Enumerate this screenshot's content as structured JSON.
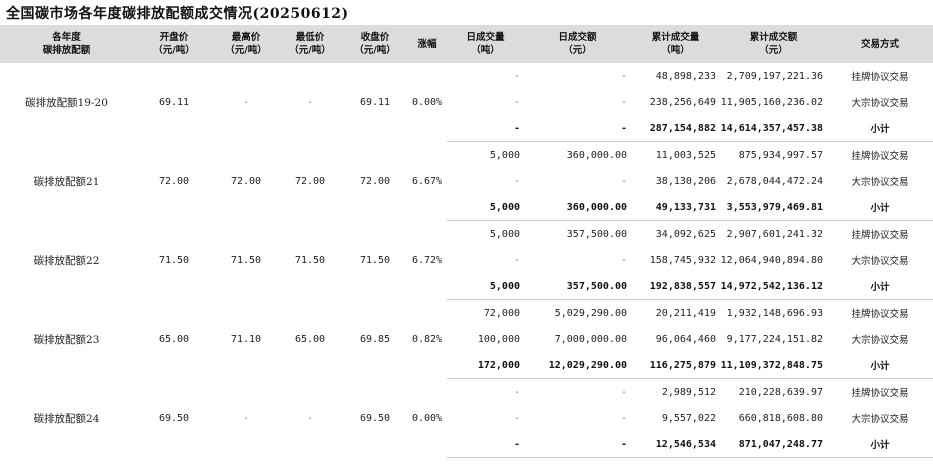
{
  "title": "全国碳市场各年度碳排放配额成交情况(20250612)",
  "headers": [
    [
      "各年度",
      "碳排放配额"
    ],
    [
      "开盘价",
      "（元/吨）"
    ],
    [
      "最高价",
      "（元/吨）"
    ],
    [
      "最低价",
      "（元/吨）"
    ],
    [
      "收盘价",
      "（元/吨）"
    ],
    [
      "涨幅",
      ""
    ],
    [
      "日成交量",
      "（吨）"
    ],
    [
      "日成交额",
      "（元）"
    ],
    [
      "累计成交量",
      "（吨）"
    ],
    [
      "累计成交额",
      "（元）"
    ],
    [
      "交易方式",
      ""
    ]
  ],
  "groups": [
    {
      "name": "碳排放配额19-20",
      "open": "69.11",
      "high": "-",
      "low": "-",
      "close": "69.11",
      "change": "0.00%",
      "rows": [
        {
          "vol": "-",
          "amt": "-",
          "cum_vol": "48,898,233",
          "cum_amt": "2,709,197,221.36",
          "mode": "挂牌协议交易"
        },
        {
          "vol": "-",
          "amt": "-",
          "cum_vol": "238,256,649",
          "cum_amt": "11,905,160,236.02",
          "mode": "大宗协议交易"
        },
        {
          "vol": "-",
          "amt": "-",
          "cum_vol": "287,154,882",
          "cum_amt": "14,614,357,457.38",
          "mode": "小计"
        }
      ]
    },
    {
      "name": "碳排放配额21",
      "open": "72.00",
      "high": "72.00",
      "low": "72.00",
      "close": "72.00",
      "change": "6.67%",
      "rows": [
        {
          "vol": "5,000",
          "amt": "360,000.00",
          "cum_vol": "11,003,525",
          "cum_amt": "875,934,997.57",
          "mode": "挂牌协议交易"
        },
        {
          "vol": "-",
          "amt": "-",
          "cum_vol": "38,130,206",
          "cum_amt": "2,678,044,472.24",
          "mode": "大宗协议交易"
        },
        {
          "vol": "5,000",
          "amt": "360,000.00",
          "cum_vol": "49,133,731",
          "cum_amt": "3,553,979,469.81",
          "mode": "小计"
        }
      ]
    },
    {
      "name": "碳排放配额22",
      "open": "71.50",
      "high": "71.50",
      "low": "71.50",
      "close": "71.50",
      "change": "6.72%",
      "rows": [
        {
          "vol": "5,000",
          "amt": "357,500.00",
          "cum_vol": "34,092,625",
          "cum_amt": "2,907,601,241.32",
          "mode": "挂牌协议交易"
        },
        {
          "vol": "-",
          "amt": "-",
          "cum_vol": "158,745,932",
          "cum_amt": "12,064,940,894.80",
          "mode": "大宗协议交易"
        },
        {
          "vol": "5,000",
          "amt": "357,500.00",
          "cum_vol": "192,838,557",
          "cum_amt": "14,972,542,136.12",
          "mode": "小计"
        }
      ]
    },
    {
      "name": "碳排放配额23",
      "open": "65.00",
      "high": "71.10",
      "low": "65.00",
      "close": "69.85",
      "change": "0.82%",
      "rows": [
        {
          "vol": "72,000",
          "amt": "5,029,290.00",
          "cum_vol": "20,211,419",
          "cum_amt": "1,932,148,696.93",
          "mode": "挂牌协议交易"
        },
        {
          "vol": "100,000",
          "amt": "7,000,000.00",
          "cum_vol": "96,064,460",
          "cum_amt": "9,177,224,151.82",
          "mode": "大宗协议交易"
        },
        {
          "vol": "172,000",
          "amt": "12,029,290.00",
          "cum_vol": "116,275,879",
          "cum_amt": "11,109,372,848.75",
          "mode": "小计"
        }
      ]
    },
    {
      "name": "碳排放配额24",
      "open": "69.50",
      "high": "-",
      "low": "-",
      "close": "69.50",
      "change": "0.00%",
      "rows": [
        {
          "vol": "-",
          "amt": "-",
          "cum_vol": "2,989,512",
          "cum_amt": "210,228,639.97",
          "mode": "挂牌协议交易"
        },
        {
          "vol": "-",
          "amt": "-",
          "cum_vol": "9,557,022",
          "cum_amt": "660,818,608.80",
          "mode": "大宗协议交易"
        },
        {
          "vol": "-",
          "amt": "-",
          "cum_vol": "12,546,534",
          "cum_amt": "871,047,248.77",
          "mode": "小计"
        }
      ]
    }
  ]
}
